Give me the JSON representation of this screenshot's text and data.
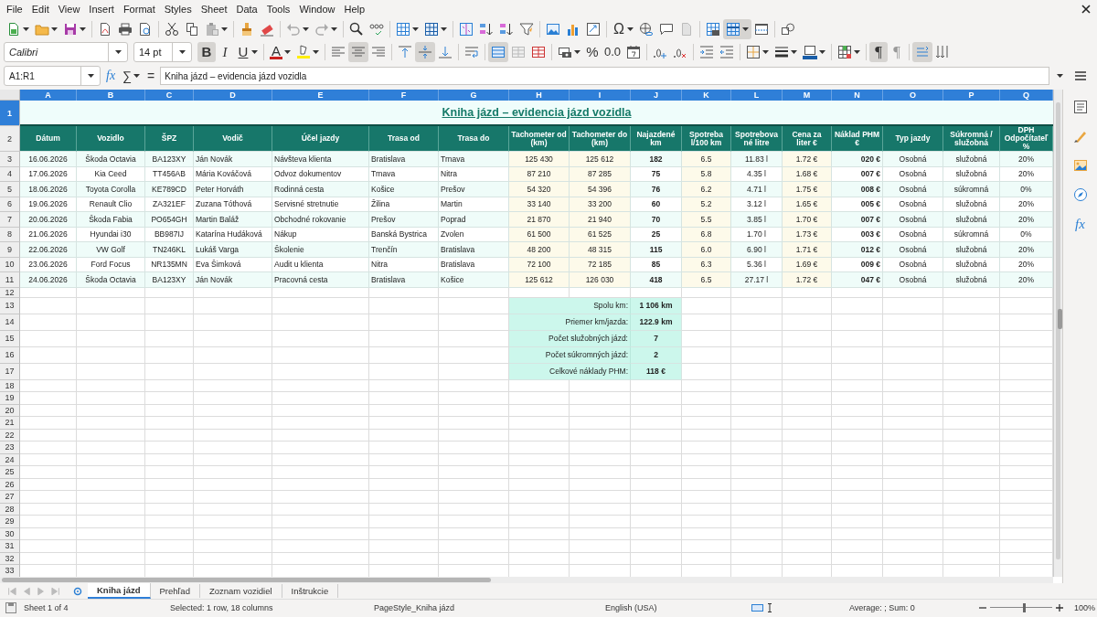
{
  "menu": [
    "File",
    "Edit",
    "View",
    "Insert",
    "Format",
    "Styles",
    "Sheet",
    "Data",
    "Tools",
    "Window",
    "Help"
  ],
  "toolbar_standard": [
    {
      "kind": "new",
      "dropdown": true,
      "pressed": false
    },
    {
      "kind": "open",
      "dropdown": true,
      "pressed": false
    },
    {
      "kind": "save",
      "dropdown": true,
      "pressed": false
    },
    {
      "kind": "separator"
    },
    {
      "kind": "pdf",
      "dropdown": false,
      "pressed": false
    },
    {
      "kind": "print",
      "dropdown": false,
      "pressed": false
    },
    {
      "kind": "preview",
      "dropdown": false,
      "pressed": false
    },
    {
      "kind": "separator"
    },
    {
      "kind": "cut",
      "dropdown": false,
      "pressed": false
    },
    {
      "kind": "copy",
      "dropdown": false,
      "pressed": false
    },
    {
      "kind": "paste",
      "dropdown": true,
      "pressed": false
    },
    {
      "kind": "separator"
    },
    {
      "kind": "clone",
      "dropdown": false,
      "pressed": false
    },
    {
      "kind": "clear",
      "dropdown": false,
      "pressed": false
    },
    {
      "kind": "separator"
    },
    {
      "kind": "undo",
      "dropdown": true,
      "pressed": false
    },
    {
      "kind": "redo",
      "dropdown": true,
      "pressed": false
    },
    {
      "kind": "separator"
    },
    {
      "kind": "find",
      "dropdown": false,
      "pressed": false
    },
    {
      "kind": "spell",
      "dropdown": false,
      "pressed": false
    },
    {
      "kind": "separator"
    },
    {
      "kind": "rows",
      "dropdown": true,
      "pressed": false
    },
    {
      "kind": "cols",
      "dropdown": true,
      "pressed": false
    },
    {
      "kind": "separator"
    },
    {
      "kind": "sort",
      "dropdown": false,
      "pressed": false
    },
    {
      "kind": "sortasc",
      "dropdown": false,
      "pressed": false
    },
    {
      "kind": "sortdesc",
      "dropdown": false,
      "pressed": false
    },
    {
      "kind": "filter",
      "dropdown": false,
      "pressed": false
    },
    {
      "kind": "separator"
    },
    {
      "kind": "image",
      "dropdown": false,
      "pressed": false
    },
    {
      "kind": "chart",
      "dropdown": false,
      "pressed": false
    },
    {
      "kind": "pivot",
      "dropdown": false,
      "pressed": false
    },
    {
      "kind": "separator"
    },
    {
      "kind": "special",
      "label": "Ω",
      "dropdown": true,
      "pressed": false
    },
    {
      "kind": "link",
      "dropdown": false,
      "pressed": false
    },
    {
      "kind": "comment",
      "dropdown": false,
      "pressed": false
    },
    {
      "kind": "headers",
      "dropdown": false,
      "pressed": false
    },
    {
      "kind": "separator"
    },
    {
      "kind": "printarea",
      "dropdown": false,
      "pressed": false
    },
    {
      "kind": "freeze",
      "dropdown": true,
      "pressed": true
    },
    {
      "kind": "split",
      "dropdown": false,
      "pressed": false
    },
    {
      "kind": "separator"
    },
    {
      "kind": "shapes",
      "dropdown": false,
      "pressed": false
    }
  ],
  "toolbar_format": {
    "font_name": "Calibri",
    "font_size": "14 pt",
    "tools": [
      {
        "kind": "bold",
        "label": "B",
        "dropdown": false,
        "pressed": true
      },
      {
        "kind": "italic",
        "label": "I",
        "dropdown": false,
        "pressed": false
      },
      {
        "kind": "underline",
        "label": "U",
        "dropdown": true,
        "pressed": false
      },
      {
        "kind": "separator"
      },
      {
        "kind": "fontcolor",
        "label": "A",
        "dropdown": true,
        "pressed": false
      },
      {
        "kind": "highlight",
        "dropdown": true,
        "pressed": false
      },
      {
        "kind": "separator"
      },
      {
        "kind": "alignleft",
        "dropdown": false,
        "pressed": false
      },
      {
        "kind": "aligncenter",
        "dropdown": false,
        "pressed": true
      },
      {
        "kind": "alignright",
        "dropdown": false,
        "pressed": false
      },
      {
        "kind": "separator"
      },
      {
        "kind": "aligntop",
        "dropdown": false,
        "pressed": false
      },
      {
        "kind": "alignmiddle",
        "dropdown": false,
        "pressed": true
      },
      {
        "kind": "alignbottom",
        "dropdown": false,
        "pressed": false
      },
      {
        "kind": "separator"
      },
      {
        "kind": "wrap",
        "dropdown": false,
        "pressed": false
      },
      {
        "kind": "separator"
      },
      {
        "kind": "merge",
        "dropdown": false,
        "pressed": true
      },
      {
        "kind": "mergeoff",
        "dropdown": false,
        "pressed": false
      },
      {
        "kind": "unmerge",
        "dropdown": false,
        "pressed": false
      },
      {
        "kind": "separator"
      },
      {
        "kind": "currency",
        "dropdown": true,
        "pressed": false
      },
      {
        "kind": "percent",
        "label": "%",
        "dropdown": false,
        "pressed": false
      },
      {
        "kind": "number",
        "label": "0.0",
        "dropdown": false,
        "pressed": false
      },
      {
        "kind": "date",
        "dropdown": false,
        "pressed": false
      },
      {
        "kind": "separator"
      },
      {
        "kind": "adddec",
        "dropdown": false,
        "pressed": false
      },
      {
        "kind": "deldec",
        "dropdown": false,
        "pressed": false
      },
      {
        "kind": "separator"
      },
      {
        "kind": "indentinc",
        "dropdown": false,
        "pressed": false
      },
      {
        "kind": "indentdec",
        "dropdown": false,
        "pressed": false
      },
      {
        "kind": "separator"
      },
      {
        "kind": "borders",
        "dropdown": true,
        "pressed": false
      },
      {
        "kind": "borderstyle",
        "dropdown": true,
        "pressed": false
      },
      {
        "kind": "bordercolor",
        "dropdown": true,
        "pressed": false
      },
      {
        "kind": "separator"
      },
      {
        "kind": "conditional",
        "dropdown": true,
        "pressed": false
      },
      {
        "kind": "separator"
      },
      {
        "kind": "ltr",
        "label": "¶",
        "dropdown": false,
        "pressed": true
      },
      {
        "kind": "rtl",
        "label": "¶",
        "dropdown": false,
        "pressed": false
      },
      {
        "kind": "separator"
      },
      {
        "kind": "textdir",
        "dropdown": false,
        "pressed": true
      },
      {
        "kind": "stacked",
        "dropdown": false,
        "pressed": false
      }
    ]
  },
  "formula_bar": {
    "cell_ref": "A1:R1",
    "function_wizard": "fx",
    "sum": "∑",
    "formula": "=",
    "content": "Kniha jázd – evidencia jázd vozidla"
  },
  "sheet": {
    "columns": [
      {
        "label": "A",
        "selected": true
      },
      {
        "label": "B",
        "selected": true
      },
      {
        "label": "C",
        "selected": true
      },
      {
        "label": "D",
        "selected": true
      },
      {
        "label": "E",
        "selected": true
      },
      {
        "label": "F",
        "selected": true
      },
      {
        "label": "G",
        "selected": true
      },
      {
        "label": "H",
        "selected": true
      },
      {
        "label": "I",
        "selected": true
      },
      {
        "label": "J",
        "selected": true
      },
      {
        "label": "K",
        "selected": true
      },
      {
        "label": "L",
        "selected": true
      },
      {
        "label": "M",
        "selected": true
      },
      {
        "label": "N",
        "selected": true
      },
      {
        "label": "O",
        "selected": true
      },
      {
        "label": "P",
        "selected": true
      },
      {
        "label": "Q",
        "selected": true
      }
    ],
    "row_numbers": [
      {
        "label": "1",
        "selected": true
      },
      {
        "label": "2",
        "selected": false
      },
      {
        "label": "3",
        "selected": false
      },
      {
        "label": "4",
        "selected": false
      },
      {
        "label": "5",
        "selected": false
      },
      {
        "label": "6",
        "selected": false
      },
      {
        "label": "7",
        "selected": false
      },
      {
        "label": "8",
        "selected": false
      },
      {
        "label": "9",
        "selected": false
      },
      {
        "label": "10",
        "selected": false
      },
      {
        "label": "11",
        "selected": false
      },
      {
        "label": "12",
        "selected": false
      },
      {
        "label": "13",
        "selected": false
      },
      {
        "label": "14",
        "selected": false
      },
      {
        "label": "15",
        "selected": false
      },
      {
        "label": "16",
        "selected": false
      },
      {
        "label": "17",
        "selected": false
      },
      {
        "label": "18",
        "selected": false
      },
      {
        "label": "19",
        "selected": false
      },
      {
        "label": "20",
        "selected": false
      },
      {
        "label": "21",
        "selected": false
      },
      {
        "label": "22",
        "selected": false
      },
      {
        "label": "23",
        "selected": false
      },
      {
        "label": "24",
        "selected": false
      },
      {
        "label": "25",
        "selected": false
      },
      {
        "label": "26",
        "selected": false
      },
      {
        "label": "27",
        "selected": false
      },
      {
        "label": "28",
        "selected": false
      },
      {
        "label": "29",
        "selected": false
      },
      {
        "label": "30",
        "selected": false
      },
      {
        "label": "31",
        "selected": false
      },
      {
        "label": "32",
        "selected": false
      },
      {
        "label": "33",
        "selected": false
      }
    ],
    "title": "Kniha jázd – evidencia jázd vozidla",
    "headers": [
      {
        "label": "Dátum",
        "kind": "center"
      },
      {
        "label": "Vozidlo",
        "kind": "center"
      },
      {
        "label": "ŠPZ",
        "kind": "center"
      },
      {
        "label": "Vodič",
        "kind": "left"
      },
      {
        "label": "Účel jazdy",
        "kind": "left"
      },
      {
        "label": "Trasa od",
        "kind": "left"
      },
      {
        "label": "Trasa do",
        "kind": "left"
      },
      {
        "label": "Tachometer od (km)",
        "kind": "input"
      },
      {
        "label": "Tachometer do (km)",
        "kind": "input"
      },
      {
        "label": "Najazdené km",
        "kind": "total"
      },
      {
        "label": "Spotreba l/100 km",
        "kind": "input"
      },
      {
        "label": "Spotrebované litre",
        "kind": "center"
      },
      {
        "label": "Cena za liter €",
        "kind": "input"
      },
      {
        "label": "Náklad PHM €",
        "kind": "cost"
      },
      {
        "label": "Typ jazdy",
        "kind": "center"
      },
      {
        "label": "Súkromná / služobná",
        "kind": "center"
      },
      {
        "label": "DPH Odpočítateľ %",
        "kind": "center"
      }
    ],
    "rows": [
      [
        "16.06.2026",
        "Škoda Octavia",
        "BA123XY",
        "Ján Novák",
        "Návšteva klienta",
        "Bratislava",
        "Trnava",
        "125 430",
        "125 612",
        "182",
        "6.5",
        "11.83 l",
        "1.72 €",
        "020 €",
        "Osobná",
        "služobná",
        "20%"
      ],
      [
        "17.06.2026",
        "Kia Ceed",
        "TT456AB",
        "Mária Kováčová",
        "Odvoz dokumentov",
        "Trnava",
        "Nitra",
        "87 210",
        "87 285",
        "75",
        "5.8",
        "4.35 l",
        "1.68 €",
        "007 €",
        "Osobná",
        "služobná",
        "20%"
      ],
      [
        "18.06.2026",
        "Toyota Corolla",
        "KE789CD",
        "Peter Horváth",
        "Rodinná cesta",
        "Košice",
        "Prešov",
        "54 320",
        "54 396",
        "76",
        "6.2",
        "4.71 l",
        "1.75 €",
        "008 €",
        "Osobná",
        "súkromná",
        "0%"
      ],
      [
        "19.06.2026",
        "Renault Clio",
        "ZA321EF",
        "Zuzana Tóthová",
        "Servisné stretnutie",
        "Žilina",
        "Martin",
        "33 140",
        "33 200",
        "60",
        "5.2",
        "3.12 l",
        "1.65 €",
        "005 €",
        "Osobná",
        "služobná",
        "20%"
      ],
      [
        "20.06.2026",
        "Škoda Fabia",
        "PO654GH",
        "Martin Baláž",
        "Obchodné rokovanie",
        "Prešov",
        "Poprad",
        "21 870",
        "21 940",
        "70",
        "5.5",
        "3.85 l",
        "1.70 €",
        "007 €",
        "Osobná",
        "služobná",
        "20%"
      ],
      [
        "21.06.2026",
        "Hyundai i30",
        "BB987IJ",
        "Katarína Hudáková",
        "Nákup",
        "Banská Bystrica",
        "Zvolen",
        "61 500",
        "61 525",
        "25",
        "6.8",
        "1.70 l",
        "1.73 €",
        "003 €",
        "Osobná",
        "súkromná",
        "0%"
      ],
      [
        "22.06.2026",
        "VW Golf",
        "TN246KL",
        "Lukáš Varga",
        "Školenie",
        "Trenčín",
        "Bratislava",
        "48 200",
        "48 315",
        "115",
        "6.0",
        "6.90 l",
        "1.71 €",
        "012 €",
        "Osobná",
        "služobná",
        "20%"
      ],
      [
        "23.06.2026",
        "Ford Focus",
        "NR135MN",
        "Eva Šimková",
        "Audit u klienta",
        "Nitra",
        "Bratislava",
        "72 100",
        "72 185",
        "85",
        "6.3",
        "5.36 l",
        "1.69 €",
        "009 €",
        "Osobná",
        "služobná",
        "20%"
      ],
      [
        "24.06.2026",
        "Škoda Octavia",
        "BA123XY",
        "Ján Novák",
        "Pracovná cesta",
        "Bratislava",
        "Košice",
        "125 612",
        "126 030",
        "418",
        "6.5",
        "27.17 l",
        "1.72 €",
        "047 €",
        "Osobná",
        "služobná",
        "20%"
      ]
    ],
    "summary": [
      {
        "label": "Spolu km:",
        "value": "1 106 km"
      },
      {
        "label": "Priemer km/jazda:",
        "value": "122.9 km"
      },
      {
        "label": "Počet služobných jázd:",
        "value": "7"
      },
      {
        "label": "Počet súkromných jázd:",
        "value": "2"
      },
      {
        "label": "Celkové náklady PHM:",
        "value": "118 €"
      }
    ]
  },
  "sidebar": [
    {
      "kind": "properties"
    },
    {
      "kind": "styles"
    },
    {
      "kind": "gallery"
    },
    {
      "kind": "navigator"
    },
    {
      "kind": "functions",
      "label": "fx"
    }
  ],
  "sheet_tabs": [
    {
      "label": "Kniha jázd",
      "selected": true
    },
    {
      "label": "Prehľad",
      "selected": false
    },
    {
      "label": "Zoznam vozidiel",
      "selected": false
    },
    {
      "label": "Inštrukcie",
      "selected": false
    }
  ],
  "status_bar": {
    "sheet": "Sheet 1 of 4",
    "selection": "Selected: 1 row, 18 columns",
    "page_style": "PageStyle_Kniha jázd",
    "language": "English (USA)",
    "aggregate": "Average: ; Sum: 0",
    "zoom_slider": {
      "level": 0.55
    },
    "zoom": "100%"
  }
}
